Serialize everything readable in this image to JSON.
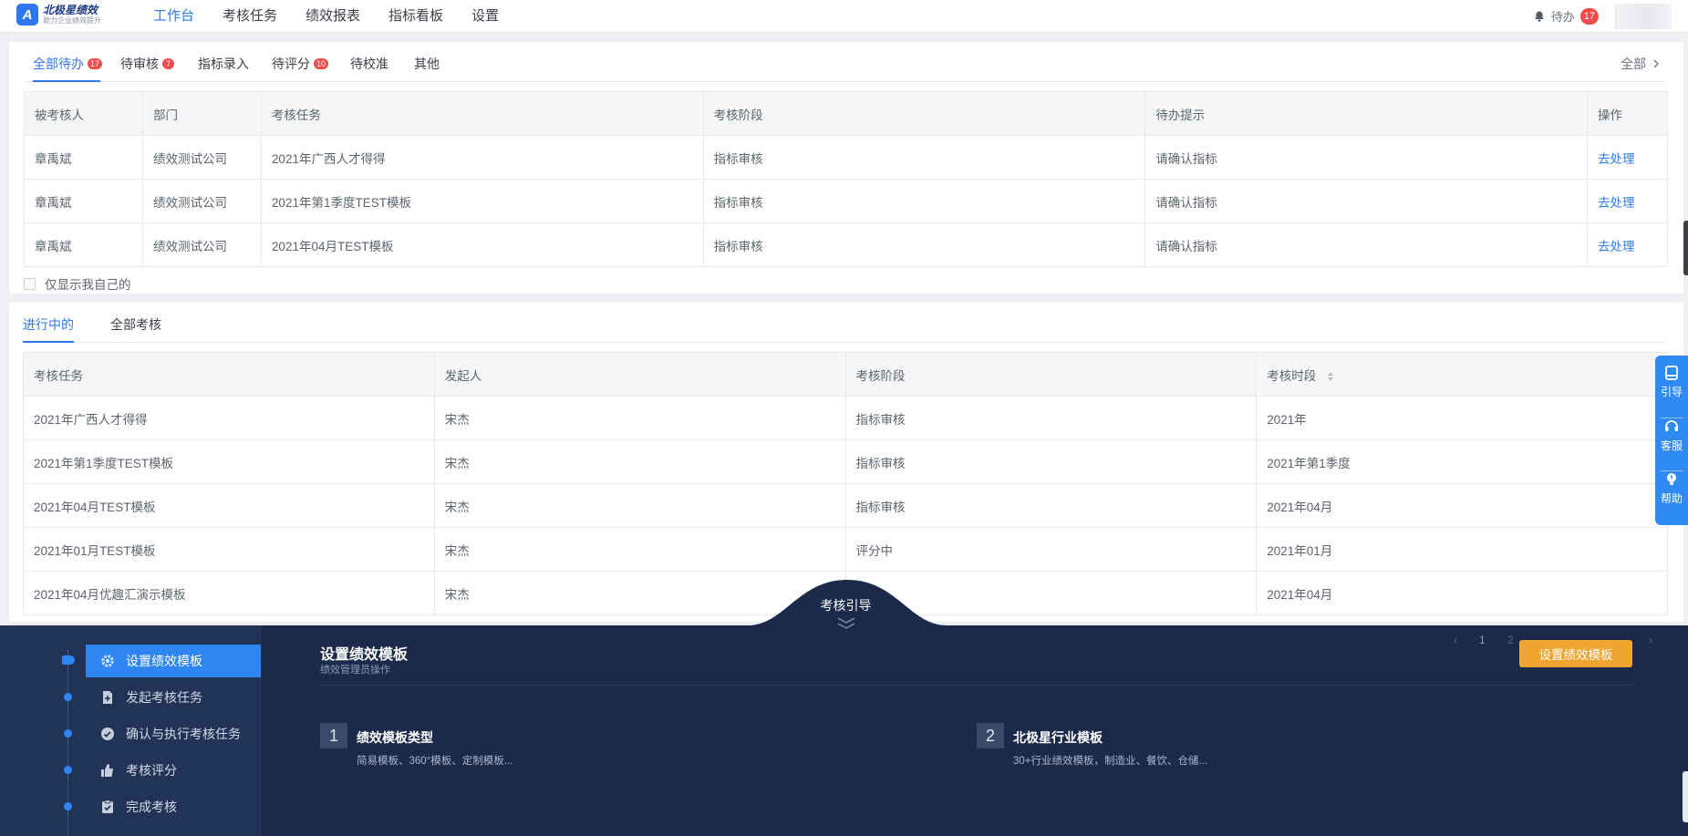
{
  "header": {
    "logo_mark": "A",
    "logo_title": "北极星绩效",
    "logo_sub": "助力企业绩效提升",
    "nav": [
      "工作台",
      "考核任务",
      "绩效报表",
      "指标看板",
      "设置"
    ],
    "todo_label": "待办",
    "todo_count": "17"
  },
  "todo_panel": {
    "tabs": [
      {
        "label": "全部待办",
        "badge": "17"
      },
      {
        "label": "待审核",
        "badge": "7"
      },
      {
        "label": "指标录入",
        "badge": ""
      },
      {
        "label": "待评分",
        "badge": "10"
      },
      {
        "label": "待校准",
        "badge": ""
      },
      {
        "label": "其他",
        "badge": ""
      }
    ],
    "all_link": "全部",
    "columns": [
      "被考核人",
      "部门",
      "考核任务",
      "考核阶段",
      "待办提示",
      "操作"
    ],
    "rows": [
      [
        "章禹斌",
        "绩效测试公司",
        "2021年广西人才得得",
        "指标审核",
        "请确认指标",
        "去处理"
      ],
      [
        "章禹斌",
        "绩效测试公司",
        "2021年第1季度TEST模板",
        "指标审核",
        "请确认指标",
        "去处理"
      ],
      [
        "章禹斌",
        "绩效测试公司",
        "2021年04月TEST模板",
        "指标审核",
        "请确认指标",
        "去处理"
      ]
    ],
    "only_mine": "仅显示我自己的"
  },
  "progress_panel": {
    "tabs": [
      "进行中的",
      "全部考核"
    ],
    "columns": [
      "考核任务",
      "发起人",
      "考核阶段",
      "考核时段"
    ],
    "rows": [
      [
        "2021年广西人才得得",
        "宋杰",
        "指标审核",
        "2021年"
      ],
      [
        "2021年第1季度TEST模板",
        "宋杰",
        "指标审核",
        "2021年第1季度"
      ],
      [
        "2021年04月TEST模板",
        "宋杰",
        "指标审核",
        "2021年04月"
      ],
      [
        "2021年01月TEST模板",
        "宋杰",
        "评分中",
        "2021年01月"
      ],
      [
        "2021年04月优趣汇演示模板",
        "宋杰",
        "",
        "2021年04月"
      ]
    ]
  },
  "helper": [
    {
      "label": "引导",
      "icon": "book-icon"
    },
    {
      "label": "客服",
      "icon": "headset-icon"
    },
    {
      "label": "帮助",
      "icon": "lightbulb-icon"
    }
  ],
  "guide": {
    "title": "考核引导",
    "steps": [
      {
        "label": "设置绩效模板",
        "icon": "gear-icon"
      },
      {
        "label": "发起考核任务",
        "icon": "add-file-icon"
      },
      {
        "label": "确认与执行考核任务",
        "icon": "check-circle-icon"
      },
      {
        "label": "考核评分",
        "icon": "thumbs-up-icon"
      },
      {
        "label": "完成考核",
        "icon": "clipboard-check-icon"
      }
    ],
    "content_title": "设置绩效模板",
    "content_sub": "绩效管理员操作",
    "button": "设置绩效模板",
    "cards": [
      {
        "num": "1",
        "title": "绩效模板类型",
        "desc": "简易模板、360°模板、定制模板..."
      },
      {
        "num": "2",
        "title": "北极星行业模板",
        "desc": "30+行业绩效模板，制造业、餐饮、仓储..."
      }
    ],
    "pager": [
      "1",
      "2"
    ]
  },
  "colors": {
    "accent": "#2f76f0",
    "badge": "#f04b4b",
    "guide_bg": "#1b2a4b",
    "cta": "#f0a531"
  }
}
